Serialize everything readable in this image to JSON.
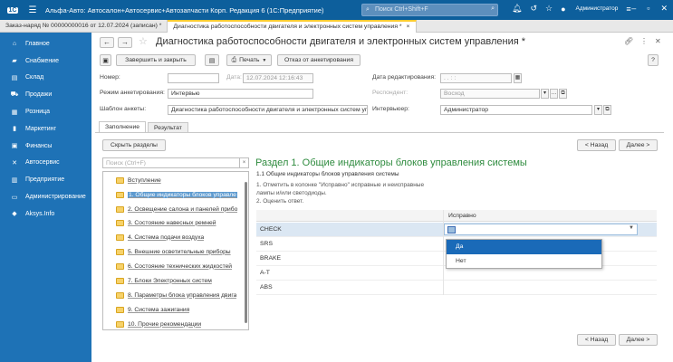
{
  "app": {
    "logo": "1С",
    "title": "Альфа-Авто: Автосалон+Автосервис+Автозапчасти Корп. Редакция 6  (1С:Предприятие)",
    "search_placeholder": "Поиск Ctrl+Shift+F",
    "user": "Администратор"
  },
  "doc_tabs": [
    {
      "label": "Заказ-наряд № 00000000016 от 12.07.2024 (записан) *"
    },
    {
      "label": "Диагностика работоспособности двигателя и электронных систем управления *",
      "close": "×"
    }
  ],
  "sidebar": {
    "items": [
      {
        "label": "Главное",
        "icon": "home-icon"
      },
      {
        "label": "Снабжение",
        "icon": "truck-icon"
      },
      {
        "label": "Склад",
        "icon": "warehouse-icon"
      },
      {
        "label": "Продажи",
        "icon": "cart-icon"
      },
      {
        "label": "Розница",
        "icon": "store-icon"
      },
      {
        "label": "Маркетинг",
        "icon": "chart-icon"
      },
      {
        "label": "Финансы",
        "icon": "finance-icon"
      },
      {
        "label": "Автосервис",
        "icon": "tools-icon"
      },
      {
        "label": "Предприятие",
        "icon": "enterprise-icon"
      },
      {
        "label": "Администрирование",
        "icon": "monitor-icon"
      },
      {
        "label": "Aksys.Info",
        "icon": "info-icon"
      }
    ]
  },
  "header": {
    "back": "←",
    "forward": "→",
    "title": "Диагностика работоспособности двигателя и электронных систем управления *"
  },
  "toolbar": {
    "save_close": "Завершить и закрыть",
    "print": "Печать",
    "cancel_survey": "Отказ от анкетирования",
    "help": "?"
  },
  "form": {
    "number_label": "Номер:",
    "number_value": "",
    "date_label": "Дата:",
    "date_value": "12.07.2024 12:16:43",
    "edit_date_label": "Дата редактирования:",
    "edit_date_value": " .  .       :  :",
    "mode_label": "Режим анкетирования:",
    "mode_value": "Интервью",
    "respondent_label": "Респондент:",
    "respondent_value": "Восход",
    "template_label": "Шаблон анкеты:",
    "template_value": "Диагностика работоспособности двигателя и электронных систем упр",
    "interviewer_label": "Интервьюер:",
    "interviewer_value": "Администратор"
  },
  "form_tabs": [
    {
      "label": "Заполнение"
    },
    {
      "label": "Результат"
    }
  ],
  "collapse_btn": "Скрыть разделы",
  "tree": {
    "search_placeholder": "Поиск (Ctrl+F)",
    "items": [
      "Вступление",
      "1. Общие индикаторы блоков управле",
      "2. Освещение салона и панелей прибо",
      "3. Состояние навесных ремней",
      "4. Система подачи воздуха",
      "5. Внешние осветительные приборы",
      "6. Состояние технических жидкостей",
      "7. Блоки Электронных систем",
      "8. Параметры блока управления двига",
      "9. Система зажигания",
      "10. Прочие рекомендации"
    ]
  },
  "nav": {
    "prev": "< Назад",
    "next": "Далее >"
  },
  "section": {
    "title": "Раздел 1. Общие индикаторы блоков управления системы",
    "question": "1.1 Общие индикаторы блоков управления системы",
    "instruction1": "1. Отметить в колонке \"Исправно\" исправные и неисправные",
    "instruction2": "лампы и/или светодиоды.",
    "instruction3": "2. Оценить ответ."
  },
  "grid": {
    "column": "Исправно",
    "rows": [
      "CHECK",
      "SRS",
      "BRAKE",
      "A-T",
      "ABS"
    ]
  },
  "dropdown": {
    "options": [
      "Да",
      "Нет"
    ],
    "selected": "Да"
  }
}
